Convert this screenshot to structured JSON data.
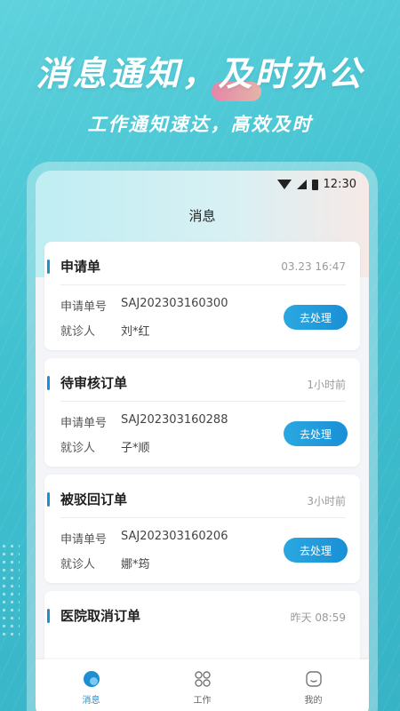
{
  "hero": {
    "title": "消息通知，及时办公",
    "subtitle": "工作通知速达，高效及时"
  },
  "status_bar": {
    "time": "12:30",
    "icons": [
      "wifi-icon",
      "signal-icon",
      "battery-icon"
    ]
  },
  "screen": {
    "title": "消息"
  },
  "cards": [
    {
      "title": "申请单",
      "time": "03.23 16:47",
      "order_label": "申请单号",
      "order_no": "SAJ202303160300",
      "patient_label": "就诊人",
      "patient": "刘*红",
      "action": "去处理"
    },
    {
      "title": "待审核订单",
      "time": "1小时前",
      "order_label": "申请单号",
      "order_no": "SAJ202303160288",
      "patient_label": "就诊人",
      "patient": "子*顺",
      "action": "去处理"
    },
    {
      "title": "被驳回订单",
      "time": "3小时前",
      "order_label": "申请单号",
      "order_no": "SAJ202303160206",
      "patient_label": "就诊人",
      "patient": "娜*筠",
      "action": "去处理"
    },
    {
      "title": "医院取消订单",
      "time": "昨天 08:59"
    }
  ],
  "tabs": [
    {
      "label": "消息",
      "icon": "message-icon",
      "active": true
    },
    {
      "label": "工作",
      "icon": "grid-icon",
      "active": false
    },
    {
      "label": "我的",
      "icon": "profile-icon",
      "active": false
    }
  ],
  "colors": {
    "accent": "#1b8fd0",
    "background": "#3fc0cf"
  }
}
